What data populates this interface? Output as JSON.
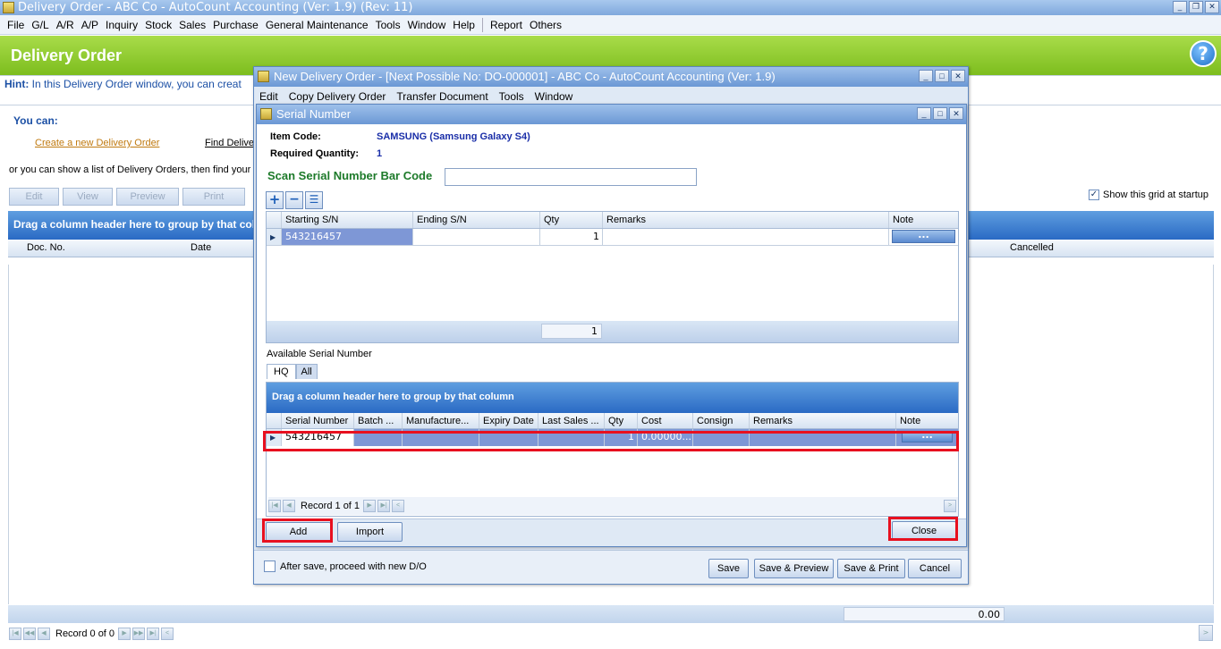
{
  "app": {
    "title": "Delivery Order - ABC Co - AutoCount Accounting (Ver: 1.9) (Rev: 11)"
  },
  "menu": [
    "File",
    "G/L",
    "A/R",
    "A/P",
    "Inquiry",
    "Stock",
    "Sales",
    "Purchase",
    "General Maintenance",
    "Tools",
    "Window",
    "Help",
    "Report",
    "Others"
  ],
  "header": {
    "title": "Delivery Order",
    "help_icon": "?"
  },
  "hint": {
    "label": "Hint:",
    "text": "In this Delivery Order window, you can creat"
  },
  "you_can": {
    "label": "You can:",
    "create_link": "Create a new Delivery Order",
    "find_link": "Find Delive",
    "list_text": "or you can show a list of Delivery Orders, then find your"
  },
  "toolbar": {
    "edit": "Edit",
    "view": "View",
    "preview": "Preview",
    "print": "Print"
  },
  "show_grid": {
    "label": "Show this grid at startup",
    "checked": true
  },
  "main_grid": {
    "group_hint": "Drag a column header here to group by that col",
    "col_doc": "Doc. No.",
    "col_date": "Date",
    "col_cancelled": "Cancelled",
    "total": "0.00",
    "record": "Record 0 of 0"
  },
  "new_do": {
    "title": "New Delivery Order - [Next Possible No: DO-000001] - ABC Co - AutoCount Accounting (Ver: 1.9)",
    "menu": [
      "Edit",
      "Copy Delivery Order",
      "Transfer Document",
      "Tools",
      "Window"
    ],
    "after_save": "After save, proceed with new D/O",
    "save": "Save",
    "save_preview": "Save & Preview",
    "save_print": "Save & Print",
    "cancel": "Cancel"
  },
  "serial": {
    "title": "Serial Number",
    "item_code_label": "Item Code:",
    "item_code": "SAMSUNG (Samsung Galaxy S4)",
    "req_qty_label": "Required Quantity:",
    "req_qty": "1",
    "scan_label": "Scan Serial Number Bar Code",
    "scan_value": "",
    "grid": {
      "cols": [
        "Starting S/N",
        "Ending S/N",
        "Qty",
        "Remarks",
        "Note"
      ],
      "row": {
        "start": "543216457",
        "end": "",
        "qty": "1",
        "remarks": "",
        "note": "..."
      },
      "total": "1"
    },
    "available_label": "Available Serial Number",
    "tabs": [
      "HQ",
      "All"
    ],
    "avail_group_hint": "Drag a column header here to group by that column",
    "avail_cols": [
      "Serial Number",
      "Batch ...",
      "Manufacture...",
      "Expiry Date",
      "Last Sales ...",
      "Qty",
      "Cost",
      "Consign",
      "Remarks",
      "Note"
    ],
    "avail_row": {
      "serial": "543216457",
      "qty": "1",
      "cost": "0.00000...",
      "note": "..."
    },
    "record": "Record 1 of 1",
    "add": "Add",
    "import": "Import",
    "close": "Close"
  }
}
